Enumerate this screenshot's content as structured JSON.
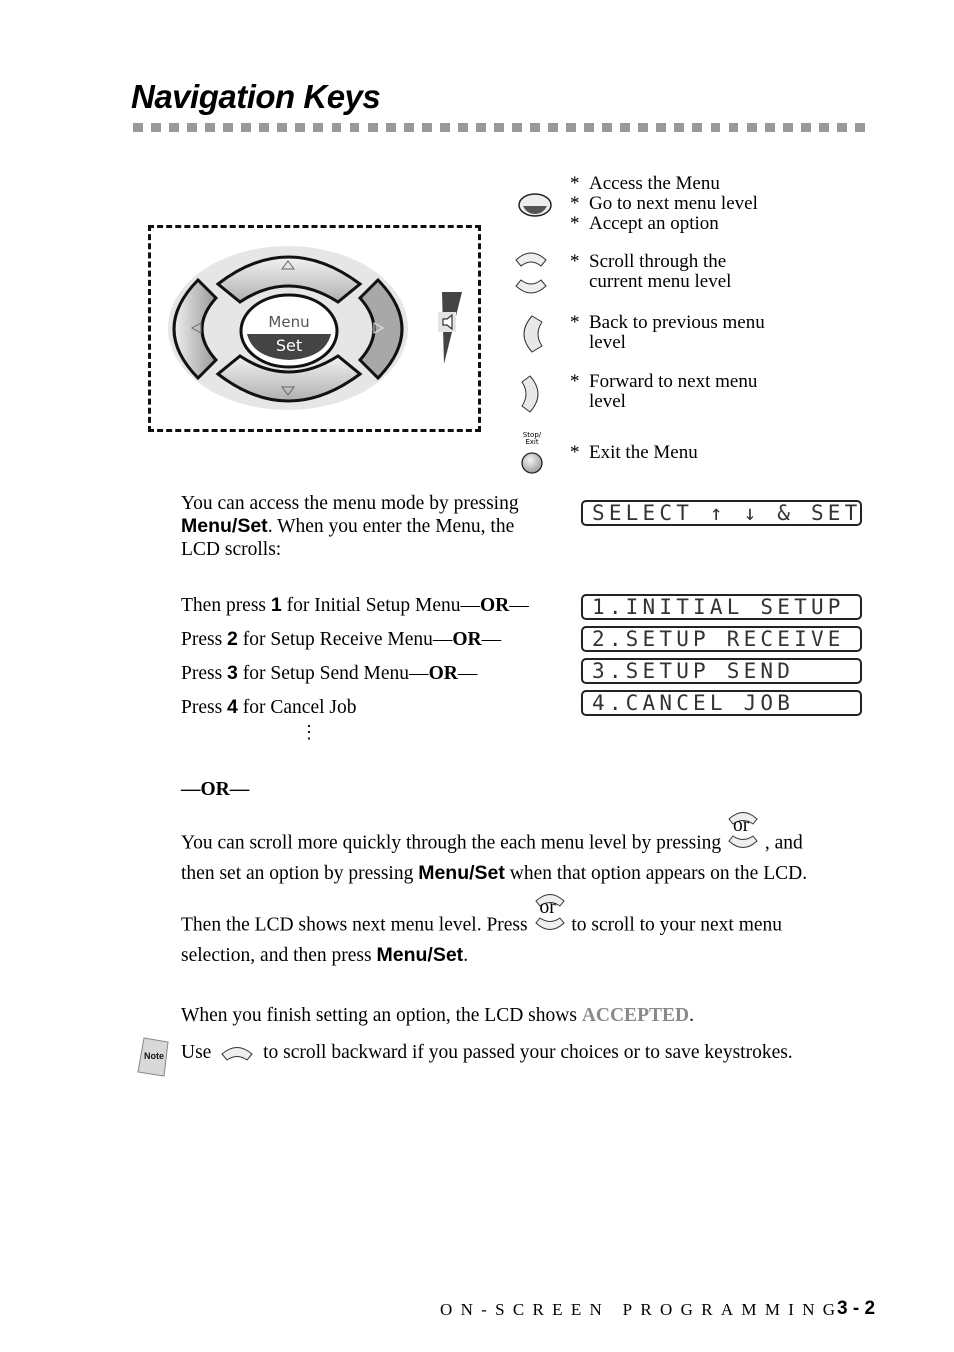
{
  "page": {
    "title": "Navigation Keys",
    "footer_section": "ON-SCREEN PROGRAMMING",
    "page_number": "3 - 2"
  },
  "panel": {
    "center_key_top": "Menu",
    "center_key_bottom": "Set"
  },
  "keys": [
    {
      "icon": "menu-set-key-icon",
      "lines": [
        "Access the Menu",
        "Go to next menu level",
        "Accept an option"
      ]
    },
    {
      "icon": "up-down-keys-icon",
      "lines": [
        "Scroll through the",
        "current menu level"
      ]
    },
    {
      "icon": "left-key-icon",
      "lines": [
        "Back to previous menu",
        "level"
      ]
    },
    {
      "icon": "right-key-icon",
      "lines": [
        "Forward to next menu",
        "level"
      ]
    },
    {
      "icon": "stop-exit-key-icon",
      "key_label_1": "Stop/",
      "key_label_2": "Exit",
      "lines": [
        "Exit the Menu"
      ]
    }
  ],
  "star": "*",
  "intro": {
    "line1": "You can access the menu mode by pressing",
    "line2_bold": "Menu/Set",
    "line2_rest": ". When you enter the Menu, the",
    "line3": "LCD scrolls:"
  },
  "lcd_select": "SELECT ↑ ↓ & SET",
  "menu_options": [
    {
      "prefix": "Then press ",
      "num": "1",
      "text": " for Initial Setup Menu—",
      "or": "OR",
      "suffix": "—",
      "lcd": "1.INITIAL SETUP"
    },
    {
      "prefix": "Press ",
      "num": "2",
      "text": " for Setup Receive Menu—",
      "or": "OR",
      "suffix": "—",
      "lcd": "2.SETUP RECEIVE"
    },
    {
      "prefix": "Press ",
      "num": "3",
      "text": " for Setup Send Menu—",
      "or": "OR",
      "suffix": "—",
      "lcd": "3.SETUP SEND"
    },
    {
      "prefix": "Press ",
      "num": "4",
      "text": " for Cancel Job",
      "or": "",
      "suffix": "",
      "lcd": "4.CANCEL JOB"
    }
  ],
  "ellipsis": "⋮",
  "or_divider": "—OR—",
  "para2": {
    "l1a": "You can scroll more quickly through the each menu level by pressing",
    "or_word": "or",
    "l1b": ", and",
    "l2a": "then set an option by pressing ",
    "l2b_bold": "Menu/Set",
    "l2c": " when that option appears on the LCD.",
    "l3a": "Then the LCD shows next menu level. Press",
    "l3b": "to scroll to your next menu",
    "l4a": "selection, and then press ",
    "l4b_bold": "Menu/Set",
    "l4c": "."
  },
  "para3": {
    "a": "When you finish setting an option, the LCD shows ",
    "accepted": "ACCEPTED",
    "b": "."
  },
  "note": {
    "badge": "Note",
    "a": "Use",
    "b": "to scroll backward if you passed your choices or to save keystrokes."
  }
}
